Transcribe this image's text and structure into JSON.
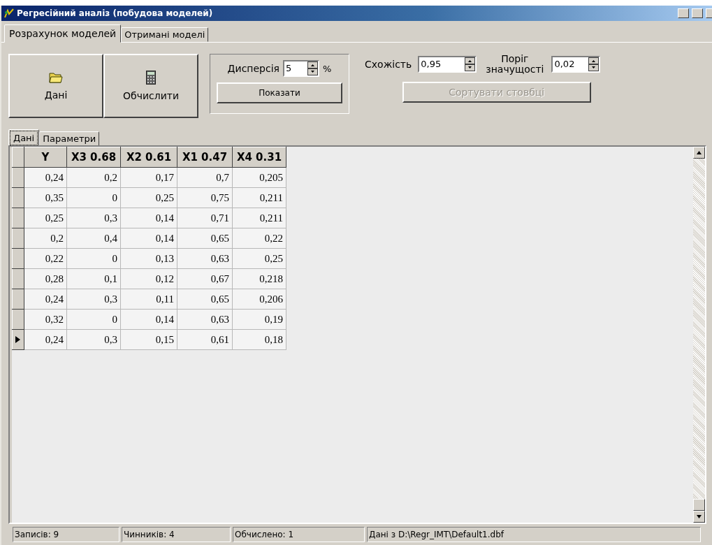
{
  "window": {
    "title": "Регресійний аналіз (побудова моделей)"
  },
  "tabs": [
    {
      "label": "Розрахунок моделей",
      "selected": true
    },
    {
      "label": "Отримані моделі",
      "selected": false
    }
  ],
  "toolbar": {
    "buttons": [
      {
        "label": "Дані",
        "kind": "open"
      },
      {
        "label": "Обчислити",
        "kind": "calc"
      }
    ],
    "dispersion": {
      "label": "Дисперсія",
      "value": "5",
      "unit": "%",
      "button": "Показати"
    },
    "similarity": {
      "label": "Схожість",
      "value": "0,95"
    },
    "threshold": {
      "label_1": "Поріг",
      "label_2": "значущості",
      "value": "0,02"
    },
    "sort_button": {
      "label": "Сортувати стовбці",
      "disabled": true
    }
  },
  "inner_tabs": [
    {
      "label": "Дані",
      "selected": true
    },
    {
      "label": "Параметри",
      "selected": false
    }
  ],
  "table": {
    "columns": [
      "Y",
      "X3 0.68",
      "X2 0.61",
      "X1 0.47",
      "X4 0.31"
    ],
    "rows": [
      {
        "cells": [
          "0,24",
          "0,2",
          "0,17",
          "0,7",
          "0,205"
        ],
        "selected": false
      },
      {
        "cells": [
          "0,35",
          "0",
          "0,25",
          "0,75",
          "0,211"
        ],
        "selected": false
      },
      {
        "cells": [
          "0,25",
          "0,3",
          "0,14",
          "0,71",
          "0,211"
        ],
        "selected": false
      },
      {
        "cells": [
          "0,2",
          "0,4",
          "0,14",
          "0,65",
          "0,22"
        ],
        "selected": false
      },
      {
        "cells": [
          "0,22",
          "0",
          "0,13",
          "0,63",
          "0,25"
        ],
        "selected": false
      },
      {
        "cells": [
          "0,28",
          "0,1",
          "0,12",
          "0,67",
          "0,218"
        ],
        "selected": false
      },
      {
        "cells": [
          "0,24",
          "0,3",
          "0,11",
          "0,65",
          "0,206"
        ],
        "selected": false
      },
      {
        "cells": [
          "0,32",
          "0",
          "0,14",
          "0,63",
          "0,19"
        ],
        "selected": false
      },
      {
        "cells": [
          "0,24",
          "0,3",
          "0,15",
          "0,61",
          "0,18"
        ],
        "selected": true
      }
    ]
  },
  "status_bar": [
    "Записів: 9",
    "Чинників: 4",
    "Обчислено: 1",
    "Дані з D:\\Regr_IMT\\Default1.dbf"
  ]
}
